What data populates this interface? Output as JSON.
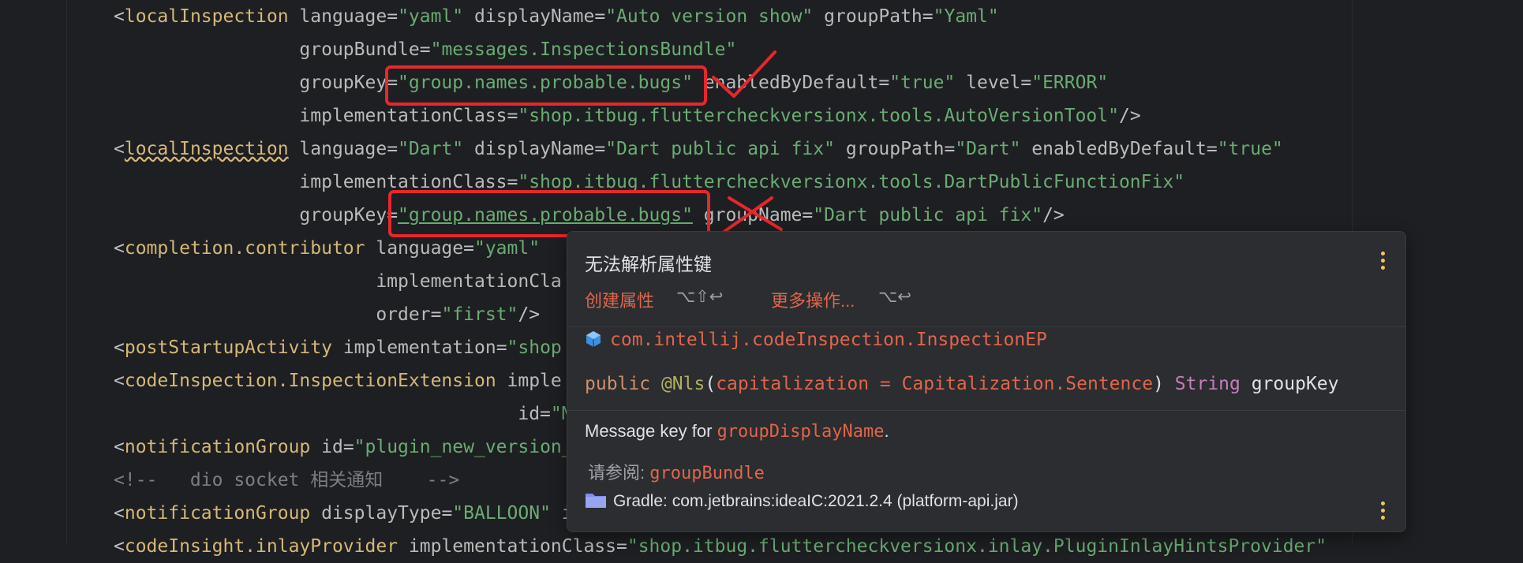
{
  "editor": {
    "lines": [
      [
        {
          "c": "punc",
          "t": "<"
        },
        {
          "c": "tag",
          "t": "localInspection"
        },
        {
          "c": "attr",
          "t": " language"
        },
        {
          "c": "punc",
          "t": "="
        },
        {
          "c": "val",
          "t": "\"yaml\""
        },
        {
          "c": "attr",
          "t": " displayName"
        },
        {
          "c": "punc",
          "t": "="
        },
        {
          "c": "val",
          "t": "\"Auto version show\""
        },
        {
          "c": "attr",
          "t": " groupPath"
        },
        {
          "c": "punc",
          "t": "="
        },
        {
          "c": "val",
          "t": "\"Yaml\""
        }
      ],
      [
        {
          "c": "attr",
          "t": "                 groupBundle"
        },
        {
          "c": "punc",
          "t": "="
        },
        {
          "c": "val",
          "t": "\"messages.InspectionsBundle\""
        }
      ],
      [
        {
          "c": "attr",
          "t": "                 groupKey"
        },
        {
          "c": "punc",
          "t": "="
        },
        {
          "c": "val",
          "t": "\"group.names.probable.bugs\""
        },
        {
          "c": "attr",
          "t": " enabledByDefault"
        },
        {
          "c": "punc",
          "t": "="
        },
        {
          "c": "val",
          "t": "\"true\""
        },
        {
          "c": "attr",
          "t": " level"
        },
        {
          "c": "punc",
          "t": "="
        },
        {
          "c": "val",
          "t": "\"ERROR\""
        }
      ],
      [
        {
          "c": "attr",
          "t": "                 implementationClass"
        },
        {
          "c": "punc",
          "t": "="
        },
        {
          "c": "val",
          "t": "\"shop.itbug.fluttercheckversionx.tools.AutoVersionTool\""
        },
        {
          "c": "punc",
          "t": "/>"
        }
      ],
      [
        {
          "c": "punc",
          "t": "<"
        },
        {
          "c": "tag squig",
          "t": "localInspection"
        },
        {
          "c": "attr",
          "t": " language"
        },
        {
          "c": "punc",
          "t": "="
        },
        {
          "c": "val",
          "t": "\"Dart\""
        },
        {
          "c": "attr",
          "t": " displayName"
        },
        {
          "c": "punc",
          "t": "="
        },
        {
          "c": "val",
          "t": "\"Dart public api fix\""
        },
        {
          "c": "attr",
          "t": " groupPath"
        },
        {
          "c": "punc",
          "t": "="
        },
        {
          "c": "val",
          "t": "\"Dart\""
        },
        {
          "c": "attr",
          "t": " enabledByDefault"
        },
        {
          "c": "punc",
          "t": "="
        },
        {
          "c": "val",
          "t": "\"true\""
        }
      ],
      [
        {
          "c": "attr",
          "t": "                 implementationClass"
        },
        {
          "c": "punc",
          "t": "="
        },
        {
          "c": "val",
          "t": "\"shop.itbug.fluttercheckversionx.tools.DartPublicFunctionFix\""
        }
      ],
      [
        {
          "c": "attr",
          "t": "                 groupKey"
        },
        {
          "c": "punc",
          "t": "="
        },
        {
          "c": "val ul",
          "t": "\"group.names.probable.bugs\""
        },
        {
          "c": "attr",
          "t": " groupName"
        },
        {
          "c": "punc",
          "t": "="
        },
        {
          "c": "val",
          "t": "\"Dart public api fix\""
        },
        {
          "c": "punc",
          "t": "/>"
        }
      ],
      [
        {
          "c": "punc",
          "t": "<"
        },
        {
          "c": "tag",
          "t": "completion.contributor"
        },
        {
          "c": "attr",
          "t": " language"
        },
        {
          "c": "punc",
          "t": "="
        },
        {
          "c": "val",
          "t": "\"yaml\""
        }
      ],
      [
        {
          "c": "attr",
          "t": "                        implementationCla"
        }
      ],
      [
        {
          "c": "attr",
          "t": "                        order"
        },
        {
          "c": "punc",
          "t": "="
        },
        {
          "c": "val",
          "t": "\"first\""
        },
        {
          "c": "punc",
          "t": "/>"
        }
      ],
      [
        {
          "c": "punc",
          "t": "<"
        },
        {
          "c": "tag",
          "t": "postStartupActivity"
        },
        {
          "c": "attr",
          "t": " implementation"
        },
        {
          "c": "punc",
          "t": "="
        },
        {
          "c": "val",
          "t": "\"shop"
        }
      ],
      [
        {
          "c": "punc",
          "t": "<"
        },
        {
          "c": "tag",
          "t": "codeInspection.InspectionExtension"
        },
        {
          "c": "attr",
          "t": " imple"
        }
      ],
      [
        {
          "c": "attr",
          "t": "                                     id"
        },
        {
          "c": "punc",
          "t": "="
        },
        {
          "c": "val",
          "t": "\"M"
        }
      ],
      [
        {
          "c": "punc",
          "t": "<"
        },
        {
          "c": "tag",
          "t": "notificationGroup"
        },
        {
          "c": "attr",
          "t": " id"
        },
        {
          "c": "punc",
          "t": "="
        },
        {
          "c": "val",
          "t": "\"plugin_new_version_"
        }
      ],
      [
        {
          "c": "cmt",
          "t": "<!--   dio socket 相关通知    -->"
        }
      ],
      [
        {
          "c": "punc",
          "t": "<"
        },
        {
          "c": "tag",
          "t": "notificationGroup"
        },
        {
          "c": "attr",
          "t": " displayType"
        },
        {
          "c": "punc",
          "t": "="
        },
        {
          "c": "val",
          "t": "\"BALLOON\""
        },
        {
          "c": "attr",
          "t": " i"
        }
      ],
      [
        {
          "c": "punc",
          "t": "<"
        },
        {
          "c": "tag",
          "t": "codeInsight.inlayProvider"
        },
        {
          "c": "attr",
          "t": " implementationClass"
        },
        {
          "c": "punc",
          "t": "="
        },
        {
          "c": "val",
          "t": "\"shop.itbug.fluttercheckversionx.inlay.PluginInlayHintsProvider\""
        }
      ]
    ]
  },
  "popup": {
    "title": "无法解析属性键",
    "action1": "创建属性",
    "action1_shortcut": "⌥⇧↩",
    "action2": "更多操作...",
    "action2_shortcut": "⌥↩",
    "fqname": "com.intellij.codeInspection.InspectionEP",
    "signature": {
      "kw": "public ",
      "ann": "@Nls",
      "open": "(",
      "param": "capitalization = Capitalization.Sentence",
      "close": ") ",
      "type": "String",
      "name": " groupKey"
    },
    "desc_pre": "Message key for ",
    "desc_link": "groupDisplayName",
    "desc_post": ".",
    "see_label": "请参阅: ",
    "see_link": "groupBundle",
    "gradle": "Gradle: com.jetbrains:ideaIC:2021.2.4 (platform-api.jar)"
  },
  "colors": {
    "annotation_red": "#e8272d",
    "link": "#e0654c",
    "kebab": "#f2c55c"
  }
}
